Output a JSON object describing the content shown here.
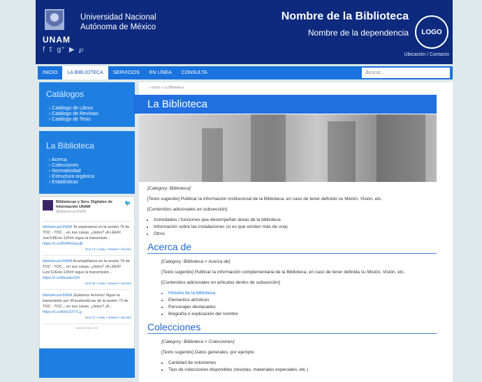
{
  "header": {
    "unam_label": "UNAM",
    "university_line1": "Universidad Nacional",
    "university_line2": "Autónoma de México",
    "library_name": "Nombre de la Biblioteca",
    "dependency_name": "Nombre de la dependencia",
    "logo_text": "LOGO",
    "location_link": "Ubicación / Contacto",
    "social_icons": [
      "facebook-icon",
      "twitter-icon",
      "google-plus-icon",
      "youtube-icon",
      "pinterest-icon"
    ]
  },
  "nav": {
    "items": [
      "INICIO",
      "LA BIBLIOTECA",
      "SERVICIOS",
      "EN LÍNEA",
      "CONSULTA"
    ],
    "active_index": 1,
    "search_placeholder": "Buscar..."
  },
  "sidebar": {
    "catalogs": {
      "title": "Catálogos",
      "links": [
        "Catálogo de Libros",
        "Catálogo de Revistas",
        "Catálogo de Tesis"
      ]
    },
    "library": {
      "title": "La Biblioteca",
      "links": [
        "Acerca",
        "Colecciones",
        "Normatividad",
        "Estructura orgánica",
        "Estadísticas"
      ]
    },
    "twitter": {
      "account_name": "Bibliotecas y Serv. Digitales de Información UNAM",
      "handle": "@bibliotecasUNAM",
      "tweets": [
        {
          "user": "bibliotecasUNAM",
          "text": " Te esperamos en la sesión 75 de TOC - TOC... en sus casas, ¿listos? ¡A LEER! Jue/14/Ene-12h## sigue la transmisió... ",
          "url": "https://t.co/B04WhasuB",
          "meta": "Ene 13 • reply • retweet • favorite"
        },
        {
          "user": "bibliotecasUNAM",
          "text": " Acompáñanos en la sesión 74 de TOC - TOC... en sus casas, ¿listos? ¡A LEER! Lun/11/Ene-12h## sigue la transmisión... ",
          "url": "https://t.co/jfaoalesSU",
          "meta": "Ene 08 • reply • retweet • favorite"
        },
        {
          "user": "bibliotecasUNAM",
          "text": " ¡Estamos #envivo! Sigue la transmisión por #FacebookLive de la sesión 73 de TOC - TOC... en sus casas, ¿listos? ¡A... ",
          "url": "https://t.co/tDiUSTrTLg",
          "meta": "Ene 07 • reply • retweet • favorite"
        }
      ],
      "footer": "wwwtomtet.com"
    }
  },
  "main": {
    "breadcrumb": "»   Inicio   »  La Biblioteca",
    "title": "La Biblioteca",
    "category": "[Category: Biblioteca]",
    "intro": "[Texto sugerido] Publicar la información institucional de la Biblioteca, en caso de tener definido su Misión, Visión, etc.",
    "additional": "[Contenidos adicionales en subsección]",
    "bullets": [
      "Actividades / funciones que desempeñan áreas de la biblioteca",
      "Información sobre las instalaciones (si es que existen más de una)",
      "Otros"
    ],
    "acerca": {
      "heading": "Acerca de",
      "category": "[Category: Biblioteca > Acerca de]",
      "text": "[Texto sugerido] Publicar la información complementaria de la Biblioteca, en caso de tener definida su Misión, Visión, etc.",
      "additional": "[Contenidos adicionales en artículos dentro de subsección]",
      "bullets": [
        "Historia de la biblioteca",
        "Elementos artísticos",
        "Personajes destacados",
        "Biografía o explicación del nombre"
      ]
    },
    "colecciones": {
      "heading": "Colecciones",
      "category": "[Category: Biblioteca > Colecciones]",
      "text": "[Texto sugerido] Datos generales, por ejemplo:",
      "bullets": [
        "Cantidad de volúmenes",
        "Tipo de colecciones disponibles (revistas, materiales especiales, etc.)"
      ]
    }
  }
}
